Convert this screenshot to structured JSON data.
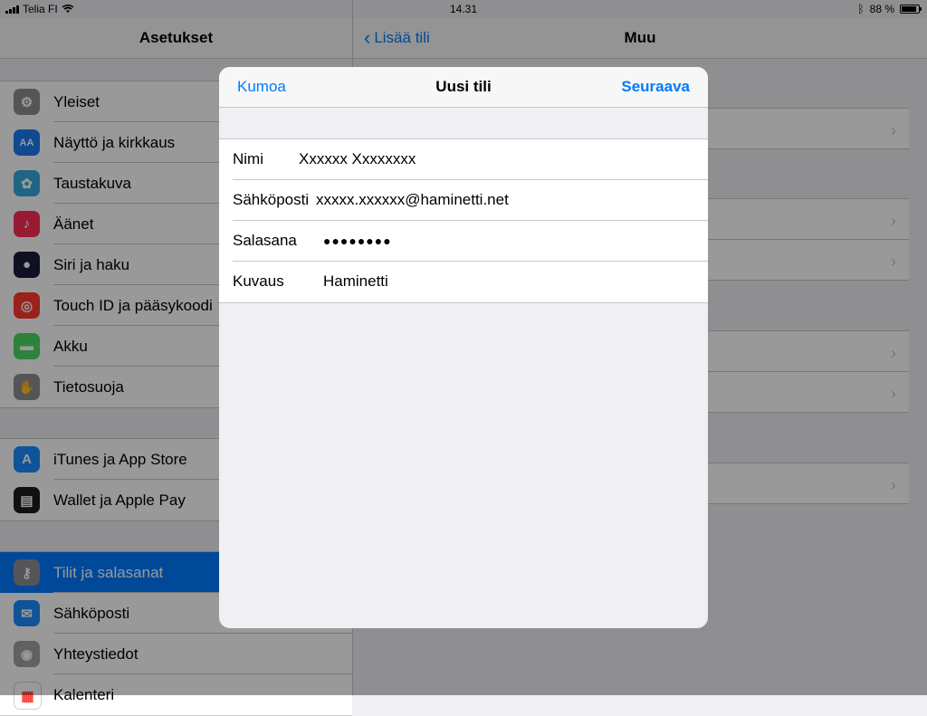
{
  "status_bar": {
    "carrier": "Telia FI",
    "time": "14.31",
    "battery": "88 %",
    "battery_level": 0.88
  },
  "left_pane": {
    "title": "Asetukset",
    "groups": [
      [
        {
          "label": "Yleiset",
          "icon": "gear-icon",
          "color": "#8e8e93"
        },
        {
          "label": "Näyttö ja kirkkaus",
          "icon": "text-size-icon",
          "color": "#1a7cf0"
        },
        {
          "label": "Taustakuva",
          "icon": "flower-icon",
          "color": "#34aadc"
        },
        {
          "label": "Äänet",
          "icon": "speaker-icon",
          "color": "#ff2d55"
        },
        {
          "label": "Siri ja haku",
          "icon": "siri-icon",
          "color": "#1c1c3c"
        },
        {
          "label": "Touch ID ja pääsykoodi",
          "icon": "fingerprint-icon",
          "color": "#ff3b30"
        },
        {
          "label": "Akku",
          "icon": "battery-icon",
          "color": "#4cd964"
        },
        {
          "label": "Tietosuoja",
          "icon": "hand-icon",
          "color": "#8e8e93"
        }
      ],
      [
        {
          "label": "iTunes ja App Store",
          "icon": "app-store-icon",
          "color": "#1a8cff"
        },
        {
          "label": "Wallet ja Apple Pay",
          "icon": "wallet-icon",
          "color": "#1c1c1e"
        }
      ],
      [
        {
          "label": "Tilit ja salasanat",
          "icon": "key-icon",
          "color": "#8e8e93",
          "selected": true
        },
        {
          "label": "Sähköposti",
          "icon": "mail-icon",
          "color": "#1a8cff"
        },
        {
          "label": "Yhteystiedot",
          "icon": "contacts-icon",
          "color": "#a2a2a7"
        },
        {
          "label": "Kalenteri",
          "icon": "calendar-icon",
          "color": "#ffffff"
        }
      ]
    ]
  },
  "right_pane": {
    "back_label": "Lisää tili",
    "title": "Muu"
  },
  "modal": {
    "cancel_label": "Kumoa",
    "title": "Uusi tili",
    "next_label": "Seuraava",
    "fields": [
      {
        "label": "Nimi",
        "value": "Xxxxxx Xxxxxxxx"
      },
      {
        "label": "Sähköposti",
        "value": "xxxxx.xxxxxx@haminetti.net"
      },
      {
        "label": "Salasana",
        "value": "●●●●●●●●"
      },
      {
        "label": "Kuvaus",
        "value": "Haminetti"
      }
    ]
  }
}
